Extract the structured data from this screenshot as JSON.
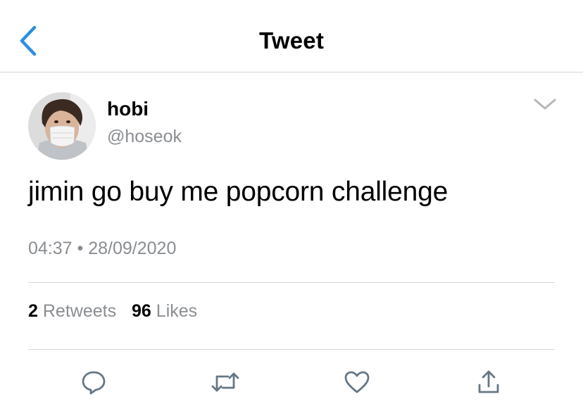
{
  "nav": {
    "title": "Tweet",
    "back_icon": "chevron-left-icon"
  },
  "tweet": {
    "author": {
      "name": "hobi",
      "handle": "@hoseok"
    },
    "text": "jimin go buy me popcorn challenge",
    "time": "04:37",
    "separator": "•",
    "date": "28/09/2020",
    "stats": {
      "retweets_count": "2",
      "retweets_label": "Retweets",
      "likes_count": "96",
      "likes_label": "Likes"
    }
  },
  "actions": [
    {
      "name": "reply",
      "icon": "reply-icon"
    },
    {
      "name": "retweet",
      "icon": "retweet-icon"
    },
    {
      "name": "like",
      "icon": "heart-icon"
    },
    {
      "name": "share",
      "icon": "share-icon"
    }
  ],
  "colors": {
    "accent": "#1da1f2",
    "muted": "#8a8d91",
    "divider": "#d6d6d6",
    "icon": "#657786"
  }
}
